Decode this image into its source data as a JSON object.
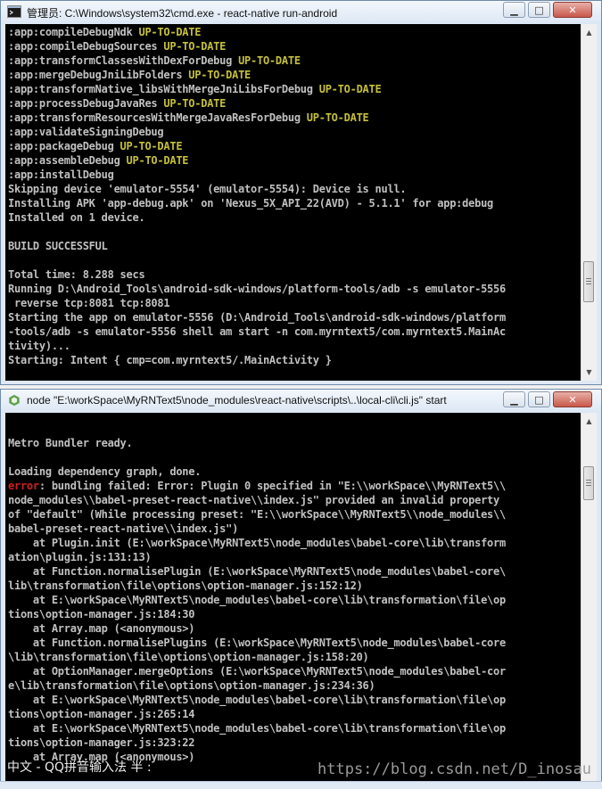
{
  "window1": {
    "title": "管理员: C:\\Windows\\system32\\cmd.exe - react-native  run-android",
    "controls": {
      "minimize": "▁",
      "maximize": "□",
      "close": "✕"
    },
    "lines": [
      [
        ":app:compileDebugNdk ",
        "UP-TO-DATE"
      ],
      [
        ":app:compileDebugSources ",
        "UP-TO-DATE"
      ],
      [
        ":app:transformClassesWithDexForDebug ",
        "UP-TO-DATE"
      ],
      [
        ":app:mergeDebugJniLibFolders ",
        "UP-TO-DATE"
      ],
      [
        ":app:transformNative_libsWithMergeJniLibsForDebug ",
        "UP-TO-DATE"
      ],
      [
        ":app:processDebugJavaRes ",
        "UP-TO-DATE"
      ],
      [
        ":app:transformResourcesWithMergeJavaResForDebug ",
        "UP-TO-DATE"
      ],
      [
        ":app:validateSigningDebug",
        ""
      ],
      [
        ":app:packageDebug ",
        "UP-TO-DATE"
      ],
      [
        ":app:assembleDebug ",
        "UP-TO-DATE"
      ],
      [
        ":app:installDebug",
        ""
      ],
      [
        "Skipping device 'emulator-5554' (emulator-5554): Device is null.",
        ""
      ],
      [
        "Installing APK 'app-debug.apk' on 'Nexus_5X_API_22(AVD) - 5.1.1' for app:debug",
        ""
      ],
      [
        "Installed on 1 device.",
        ""
      ],
      [
        "",
        ""
      ],
      [
        "BUILD SUCCESSFUL",
        ""
      ],
      [
        "",
        ""
      ],
      [
        "Total time: 8.288 secs",
        ""
      ],
      [
        "Running D:\\Android_Tools\\android-sdk-windows/platform-tools/adb -s emulator-5556",
        ""
      ],
      [
        " reverse tcp:8081 tcp:8081",
        ""
      ],
      [
        "Starting the app on emulator-5556 (D:\\Android_Tools\\android-sdk-windows/platform",
        ""
      ],
      [
        "-tools/adb -s emulator-5556 shell am start -n com.myrntext5/com.myrntext5.MainAc",
        ""
      ],
      [
        "tivity)...",
        ""
      ],
      [
        "Starting: Intent { cmp=com.myrntext5/.MainActivity }",
        ""
      ]
    ]
  },
  "window2": {
    "title": "node  \"E:\\workSpace\\MyRNText5\\node_modules\\react-native\\scripts\\..\\local-cli\\cli.js\" start",
    "controls": {
      "minimize": "▁",
      "maximize": "□",
      "close": "✕"
    },
    "lines": [
      [
        "",
        ""
      ],
      [
        "Metro Bundler ready.",
        ""
      ],
      [
        "",
        ""
      ],
      [
        "Loading dependency graph, done.",
        ""
      ],
      [
        "",
        "error",
        ": bundling failed: Error: Plugin 0 specified in \"E:\\\\workSpace\\\\MyRNText5\\\\"
      ],
      [
        "node_modules\\\\babel-preset-react-native\\\\index.js\" provided an invalid property",
        ""
      ],
      [
        "of \"default\" (While processing preset: \"E:\\\\workSpace\\\\MyRNText5\\\\node_modules\\\\",
        ""
      ],
      [
        "babel-preset-react-native\\\\index.js\")",
        ""
      ],
      [
        "    at Plugin.init (E:\\workSpace\\MyRNText5\\node_modules\\babel-core\\lib\\transform",
        ""
      ],
      [
        "ation\\plugin.js:131:13)",
        ""
      ],
      [
        "    at Function.normalisePlugin (E:\\workSpace\\MyRNText5\\node_modules\\babel-core\\",
        ""
      ],
      [
        "lib\\transformation\\file\\options\\option-manager.js:152:12)",
        ""
      ],
      [
        "    at E:\\workSpace\\MyRNText5\\node_modules\\babel-core\\lib\\transformation\\file\\op",
        ""
      ],
      [
        "tions\\option-manager.js:184:30",
        ""
      ],
      [
        "    at Array.map (<anonymous>)",
        ""
      ],
      [
        "    at Function.normalisePlugins (E:\\workSpace\\MyRNText5\\node_modules\\babel-core",
        ""
      ],
      [
        "\\lib\\transformation\\file\\options\\option-manager.js:158:20)",
        ""
      ],
      [
        "    at OptionManager.mergeOptions (E:\\workSpace\\MyRNText5\\node_modules\\babel-cor",
        ""
      ],
      [
        "e\\lib\\transformation\\file\\options\\option-manager.js:234:36)",
        ""
      ],
      [
        "    at E:\\workSpace\\MyRNText5\\node_modules\\babel-core\\lib\\transformation\\file\\op",
        ""
      ],
      [
        "tions\\option-manager.js:265:14",
        ""
      ],
      [
        "    at E:\\workSpace\\MyRNText5\\node_modules\\babel-core\\lib\\transformation\\file\\op",
        ""
      ],
      [
        "tions\\option-manager.js:323:22",
        ""
      ],
      [
        "    at Array.map (<anonymous>)",
        ""
      ]
    ]
  },
  "ime_status": "中文 - QQ拼音输入法 半 :",
  "watermark": "https://blog.csdn.net/D_inosau",
  "colors": {
    "console_bg": "#000000",
    "console_text": "#c0c0c0",
    "up_to_date": "#c4bf3a",
    "error": "#d02020"
  }
}
